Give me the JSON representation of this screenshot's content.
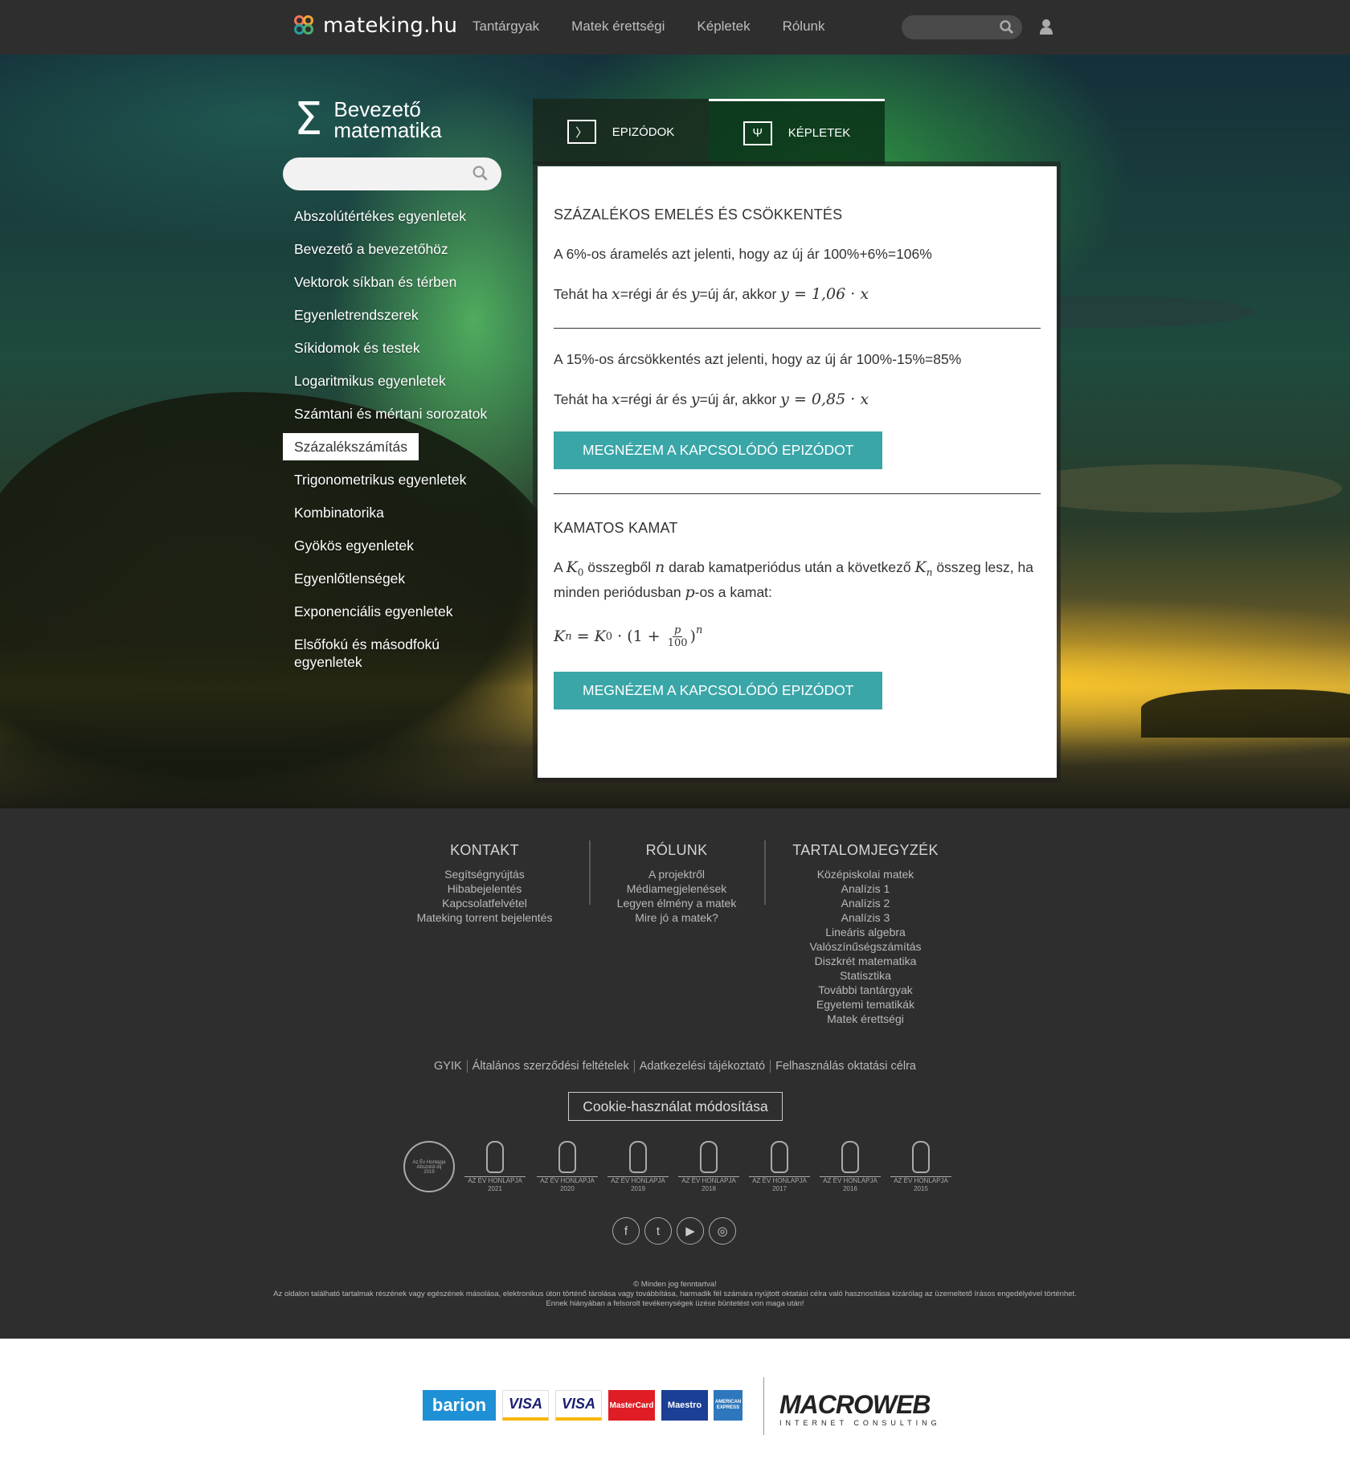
{
  "header": {
    "logo_text": "mateking.hu",
    "nav": [
      "Tantárgyak",
      "Matek érettségi",
      "Képletek",
      "Rólunk"
    ],
    "search_placeholder": "",
    "colorbar": [
      "#4caf6e",
      "#2a9d9d",
      "#2a9d9d",
      "#2a9d9d",
      "#f2a531",
      "#f2a531",
      "#f0765a",
      "#f0765a"
    ]
  },
  "sidebar": {
    "category_title_line1": "Bevezető",
    "category_title_line2": "matematika",
    "search_placeholder": "",
    "items": [
      "Abszolútértékes egyenletek",
      "Bevezető a bevezetőhöz",
      "Vektorok síkban és térben",
      "Egyenletrendszerek",
      "Síkidomok és testek",
      "Logaritmikus egyenletek",
      "Számtani és mértani sorozatok",
      "Százalékszámítás",
      "Trigonometrikus egyenletek",
      "Kombinatorika",
      "Gyökös egyenletek",
      "Egyenlőtlenségek",
      "Exponenciális egyenletek",
      "Elsőfokú és másodfokú egyenletek"
    ],
    "active_index": 7
  },
  "tabs": {
    "episodes": "EPIZÓDOK",
    "formulas": "KÉPLETEK",
    "episodes_icon": "〉",
    "formulas_icon": "Ψ"
  },
  "content": {
    "section1_title": "SZÁZALÉKOS EMELÉS ÉS CSÖKKENTÉS",
    "p1": "A 6%-os áramelés azt jelenti, hogy az új ár 100%+6%=106%",
    "p2_prefix": "Tehát ha ",
    "p2_x": "x",
    "p2_mid1": "=régi ár és ",
    "p2_y": "y",
    "p2_mid2": "=új ár, akkor ",
    "p2_formula": "y = 1,06 · x",
    "p3": "A 15%-os árcsökkentés azt jelenti, hogy az új ár 100%-15%=85%",
    "p4_formula": "y = 0,85 · x",
    "button": "MEGNÉZEM A KAPCSOLÓDÓ EPIZÓDOT",
    "section2_title": "KAMATOS KAMAT",
    "p5_a": "A ",
    "p5_k0": "K",
    "p5_k0_sub": "0",
    "p5_b": " összegből ",
    "p5_n": "n",
    "p5_c": " darab kamatperiódus után a következő ",
    "p5_kn": "K",
    "p5_kn_sub": "n",
    "p5_d": " összeg lesz, ha minden periódusban ",
    "p5_p": "p",
    "p5_e": "-os a kamat:",
    "formula_lhs": "K",
    "formula_lhs_sub": "n",
    "formula_eq": " = ",
    "formula_k0": "K",
    "formula_k0_sub": "0",
    "formula_dot": " · ",
    "formula_open": "(1 + ",
    "formula_num": "p",
    "formula_den": "100",
    "formula_close": ")",
    "formula_exp": "n"
  },
  "footer": {
    "contact_title": "KONTAKT",
    "contact": [
      "Segítségnyújtás",
      "Hibabejelentés",
      "Kapcsolatfelvétel",
      "Mateking torrent bejelentés"
    ],
    "about_title": "RÓLUNK",
    "about": [
      "A projektről",
      "Médiamegjelenések",
      "Legyen élmény a matek",
      "Mire jó a matek?"
    ],
    "toc_title": "TARTALOMJEGYZÉK",
    "toc": [
      "Középiskolai matek",
      "Analízis 1",
      "Analízis 2",
      "Analízis 3",
      "Lineáris algebra",
      "Valószínűségszámítás",
      "Diszkrét matematika",
      "Statisztika",
      "További tantárgyak",
      "Egyetemi tematikák",
      "Matek érettségi"
    ],
    "legal": [
      "GYIK",
      "Általános szerződési feltételek",
      "Adatkezelési tájékoztató",
      "Felhasználás oktatási célra"
    ],
    "cookie": "Cookie-használat módosítása",
    "award_circle_text": "Az Év Honlapja Abszolút díj 2019",
    "award_label": "AZ ÉV HONLAPJA",
    "award_years": [
      "2021",
      "2020",
      "2019",
      "2018",
      "2017",
      "2016",
      "2015"
    ],
    "socials": [
      "f",
      "t",
      "▶",
      "◎"
    ],
    "copyright_1": "© Minden jog fenntartva!",
    "copyright_2": "Az oldalon található tartalmak részének vagy egészének másolása, elektronikus úton történő tárolása vagy továbbítása, harmadik fél számára nyújtott oktatási célra való hasznosítása kizárólag az üzemeltető írásos engedélyével történhet. Ennek hiányában a felsorolt tevékenységek üzése büntetést von maga után!"
  },
  "payment": {
    "logos": [
      "barion",
      "VISA",
      "VISA",
      "MasterCard",
      "Maestro",
      "AMERICAN EXPRESS"
    ],
    "macroweb": "MACROWEB",
    "macroweb_sub": "INTERNET CONSULTING"
  }
}
